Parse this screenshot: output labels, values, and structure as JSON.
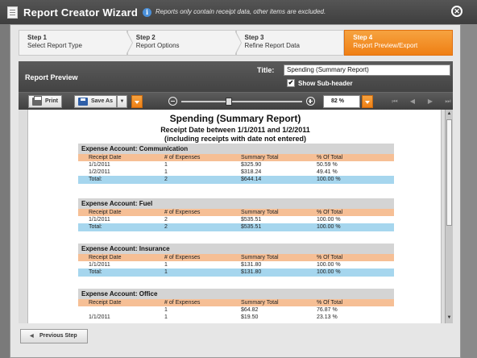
{
  "wizard": {
    "title": "Report Creator Wizard",
    "info": "Reports only contain receipt data, other items are excluded.",
    "close_glyph": "✕"
  },
  "steps": [
    {
      "num": "Step 1",
      "name": "Select Report Type"
    },
    {
      "num": "Step 2",
      "name": "Report Options"
    },
    {
      "num": "Step 3",
      "name": "Refine Report Data"
    },
    {
      "num": "Step 4",
      "name": "Report Preview/Export"
    }
  ],
  "preview": {
    "label": "Report Preview",
    "title_label": "Title:",
    "title_value": "Spending (Summary Report)",
    "show_subheader_label": "Show Sub-header",
    "show_subheader_checked": "✔"
  },
  "toolbar": {
    "print_label": "Print",
    "save_as_label": "Save As",
    "zoom_value": "82 %",
    "zoom_level_percent": 82,
    "nav_first": "⏮",
    "nav_prev": "◀",
    "nav_next": "▶",
    "nav_last": "⏭"
  },
  "report": {
    "title": "Spending (Summary Report)",
    "subtitle": "Receipt Date between 1/1/2011 and 1/2/2011",
    "subtitle2": "(including receipts with date not entered)",
    "columns": [
      "Receipt Date",
      "# of Expenses",
      "Summary Total",
      "% Of Total"
    ],
    "accounts": [
      {
        "name": "Expense Account: Communication",
        "rows": [
          [
            "1/1/2011",
            "1",
            "$325.90",
            "50.59 %"
          ],
          [
            "1/2/2011",
            "1",
            "$318.24",
            "49.41 %"
          ]
        ],
        "total": [
          "Total:",
          "2",
          "$644.14",
          "100.00 %"
        ]
      },
      {
        "name": "Expense Account: Fuel",
        "rows": [
          [
            "1/1/2011",
            "2",
            "$535.51",
            "100.00 %"
          ]
        ],
        "total": [
          "Total:",
          "2",
          "$535.51",
          "100.00 %"
        ]
      },
      {
        "name": "Expense Account: Insurance",
        "rows": [
          [
            "1/1/2011",
            "1",
            "$131.80",
            "100.00 %"
          ]
        ],
        "total": [
          "Total:",
          "1",
          "$131.80",
          "100.00 %"
        ]
      },
      {
        "name": "Expense Account: Office",
        "rows": [
          [
            "",
            "1",
            "$64.82",
            "76.87 %"
          ],
          [
            "1/1/2011",
            "1",
            "$19.50",
            "23.13 %"
          ]
        ]
      }
    ]
  },
  "footer": {
    "previous_step_label": "Previous Step"
  },
  "colors": {
    "accent_orange": "#ef7f14",
    "column_header": "#f6bf95",
    "total_row": "#a6d6ee",
    "account_header": "#d4d4d4"
  }
}
